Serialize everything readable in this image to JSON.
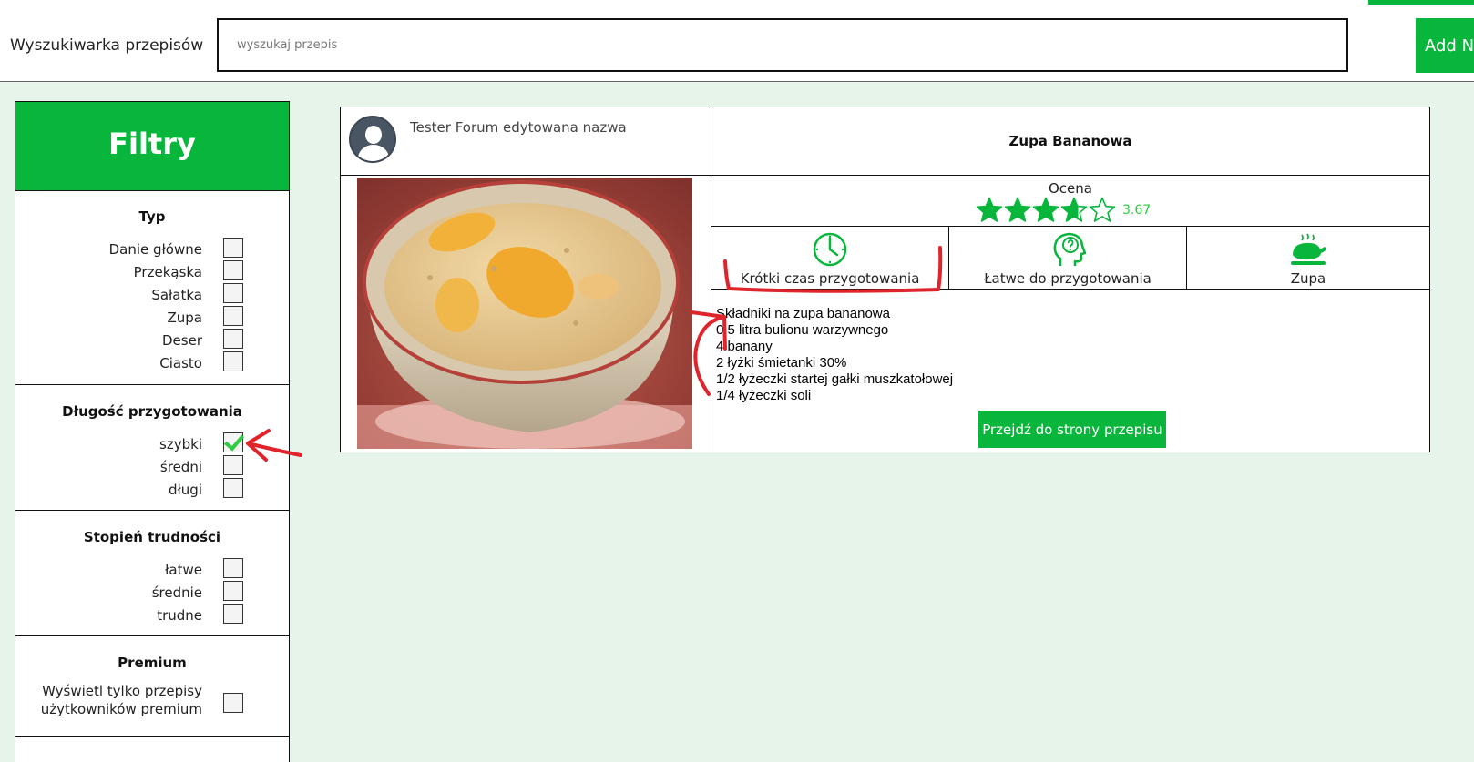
{
  "header": {
    "brand": "Wyszukiwarka przepisów",
    "search_placeholder": "wyszukaj przepis",
    "add_button_label": "Add Ne"
  },
  "sidebar": {
    "title": "Filtry",
    "sections": [
      {
        "title": "Typ",
        "options": [
          {
            "label": "Danie główne",
            "checked": false
          },
          {
            "label": "Przekąska",
            "checked": false
          },
          {
            "label": "Sałatka",
            "checked": false
          },
          {
            "label": "Zupa",
            "checked": false
          },
          {
            "label": "Deser",
            "checked": false
          },
          {
            "label": "Ciasto",
            "checked": false
          }
        ]
      },
      {
        "title": "Długość przygotowania",
        "options": [
          {
            "label": "szybki",
            "checked": true
          },
          {
            "label": "średni",
            "checked": false
          },
          {
            "label": "długi",
            "checked": false
          }
        ]
      },
      {
        "title": "Stopień trudności",
        "options": [
          {
            "label": "łatwe",
            "checked": false
          },
          {
            "label": "średnie",
            "checked": false
          },
          {
            "label": "trudne",
            "checked": false
          }
        ]
      },
      {
        "title": "Premium",
        "options": [
          {
            "label_line1": "Wyświetl tylko przepisy",
            "label_line2": "użytkowników premium",
            "checked": false
          }
        ]
      }
    ]
  },
  "recipe": {
    "author": "Tester Forum edytowana nazwa",
    "title": "Zupa Bananowa",
    "rating_label": "Ocena",
    "rating_value": "3.67",
    "rating_numeric": 3.67,
    "rating_max": 5,
    "features": [
      {
        "icon": "clock-icon",
        "label": "Krótki czas przygotowania"
      },
      {
        "icon": "head-question-icon",
        "label": "Łatwe do przygotowania"
      },
      {
        "icon": "roast-chicken-icon",
        "label": "Zupa"
      }
    ],
    "ingredients": [
      "Składniki na zupa bananowa",
      "0,5 litra bulionu warzywnego",
      "4 banany",
      "2 łyżki śmietanki 30%",
      "1/2 łyżeczki startej gałki muszkatołowej",
      "1/4 łyżeczki soli"
    ],
    "go_button_label": "Przejdź do strony przepisu"
  },
  "colors": {
    "accent": "#07b63b",
    "page_bg": "#e6f4ea",
    "annotation": "#e0242c"
  }
}
